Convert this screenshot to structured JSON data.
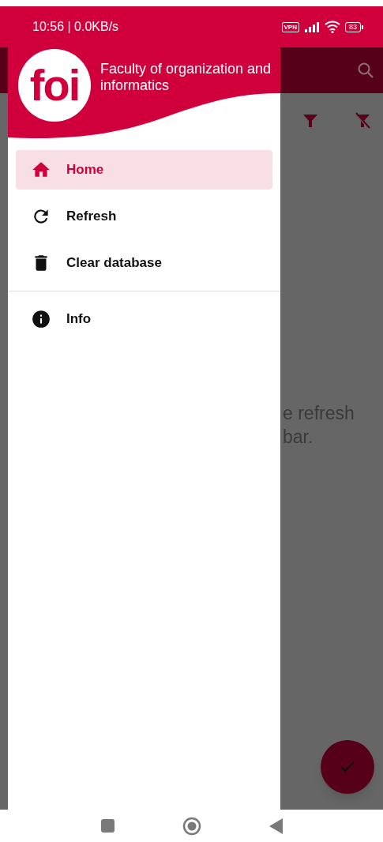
{
  "status_bar": {
    "time": "10:56 | 0.0KB/s",
    "vpn": "VPN",
    "battery": "83"
  },
  "background_app": {
    "content_lines": [
      "e refresh",
      "bar."
    ]
  },
  "drawer": {
    "header": {
      "logo": "foi",
      "title": "Faculty of organization and informatics"
    },
    "groups": [
      [
        {
          "label": "Home",
          "selected": true
        },
        {
          "label": "Refresh",
          "selected": false
        },
        {
          "label": "Clear database",
          "selected": false
        }
      ],
      [
        {
          "label": "Info",
          "selected": false
        }
      ]
    ]
  }
}
